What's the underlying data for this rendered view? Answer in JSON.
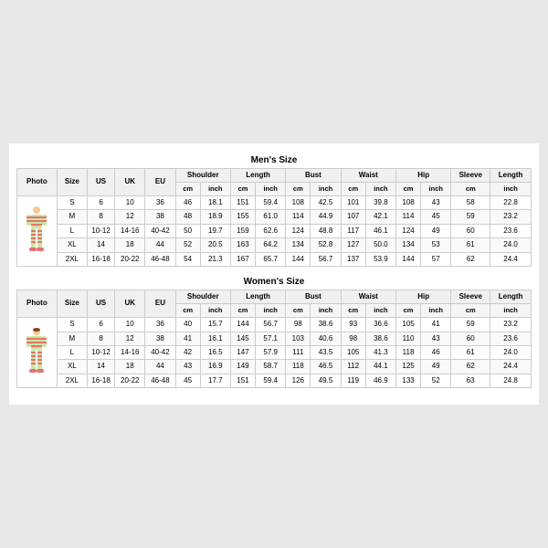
{
  "mens": {
    "title": "Men's Size",
    "columns": [
      "Photo",
      "Size",
      "US",
      "UK",
      "EU",
      "Shoulder",
      "",
      "Length",
      "",
      "Bust",
      "",
      "Waist",
      "",
      "Hip",
      "",
      "Sleeve",
      "Length"
    ],
    "subcolumns": [
      "",
      "",
      "",
      "",
      "",
      "cm",
      "inch",
      "cm",
      "inch",
      "cm",
      "inch",
      "cm",
      "inch",
      "cm",
      "inch",
      "cm",
      "inch"
    ],
    "rows": [
      [
        "S",
        "6",
        "10",
        "36",
        "46",
        "18.1",
        "151",
        "59.4",
        "108",
        "42.5",
        "101",
        "39.8",
        "108",
        "43",
        "58",
        "22.8"
      ],
      [
        "M",
        "8",
        "12",
        "38",
        "48",
        "18.9",
        "155",
        "61.0",
        "114",
        "44.9",
        "107",
        "42.1",
        "114",
        "45",
        "59",
        "23.2"
      ],
      [
        "L",
        "10-12",
        "14-16",
        "40-42",
        "50",
        "19.7",
        "159",
        "62.6",
        "124",
        "48.8",
        "117",
        "46.1",
        "124",
        "49",
        "60",
        "23.6"
      ],
      [
        "XL",
        "14",
        "18",
        "44",
        "52",
        "20.5",
        "163",
        "64.2",
        "134",
        "52.8",
        "127",
        "50.0",
        "134",
        "53",
        "61",
        "24.0"
      ],
      [
        "2XL",
        "16-18",
        "20-22",
        "46-48",
        "54",
        "21.3",
        "167",
        "65.7",
        "144",
        "56.7",
        "137",
        "53.9",
        "144",
        "57",
        "62",
        "24.4"
      ]
    ]
  },
  "womens": {
    "title": "Women's Size",
    "columns": [
      "Photo",
      "Size",
      "US",
      "UK",
      "EU",
      "Shoulder",
      "",
      "Length",
      "",
      "Bust",
      "",
      "Waist",
      "",
      "Hip",
      "",
      "Sleeve",
      "Length"
    ],
    "subcolumns": [
      "",
      "",
      "",
      "",
      "",
      "cm",
      "inch",
      "cm",
      "inch",
      "cm",
      "inch",
      "cm",
      "inch",
      "cm",
      "inch",
      "cm",
      "inch"
    ],
    "rows": [
      [
        "S",
        "6",
        "10",
        "36",
        "40",
        "15.7",
        "144",
        "56.7",
        "98",
        "38.6",
        "93",
        "36.6",
        "105",
        "41",
        "59",
        "23.2"
      ],
      [
        "M",
        "8",
        "12",
        "38",
        "41",
        "16.1",
        "145",
        "57.1",
        "103",
        "40.6",
        "98",
        "38.6",
        "110",
        "43",
        "60",
        "23.6"
      ],
      [
        "L",
        "10-12",
        "14-16",
        "40-42",
        "42",
        "16.5",
        "147",
        "57.9",
        "111",
        "43.5",
        "105",
        "41.3",
        "118",
        "46",
        "61",
        "24.0"
      ],
      [
        "XL",
        "14",
        "18",
        "44",
        "43",
        "16.9",
        "149",
        "58.7",
        "118",
        "46.5",
        "112",
        "44.1",
        "125",
        "49",
        "62",
        "24.4"
      ],
      [
        "2XL",
        "16-18",
        "20-22",
        "46-48",
        "45",
        "17.7",
        "151",
        "59.4",
        "126",
        "49.5",
        "119",
        "46.9",
        "133",
        "52",
        "63",
        "24.8"
      ]
    ]
  }
}
